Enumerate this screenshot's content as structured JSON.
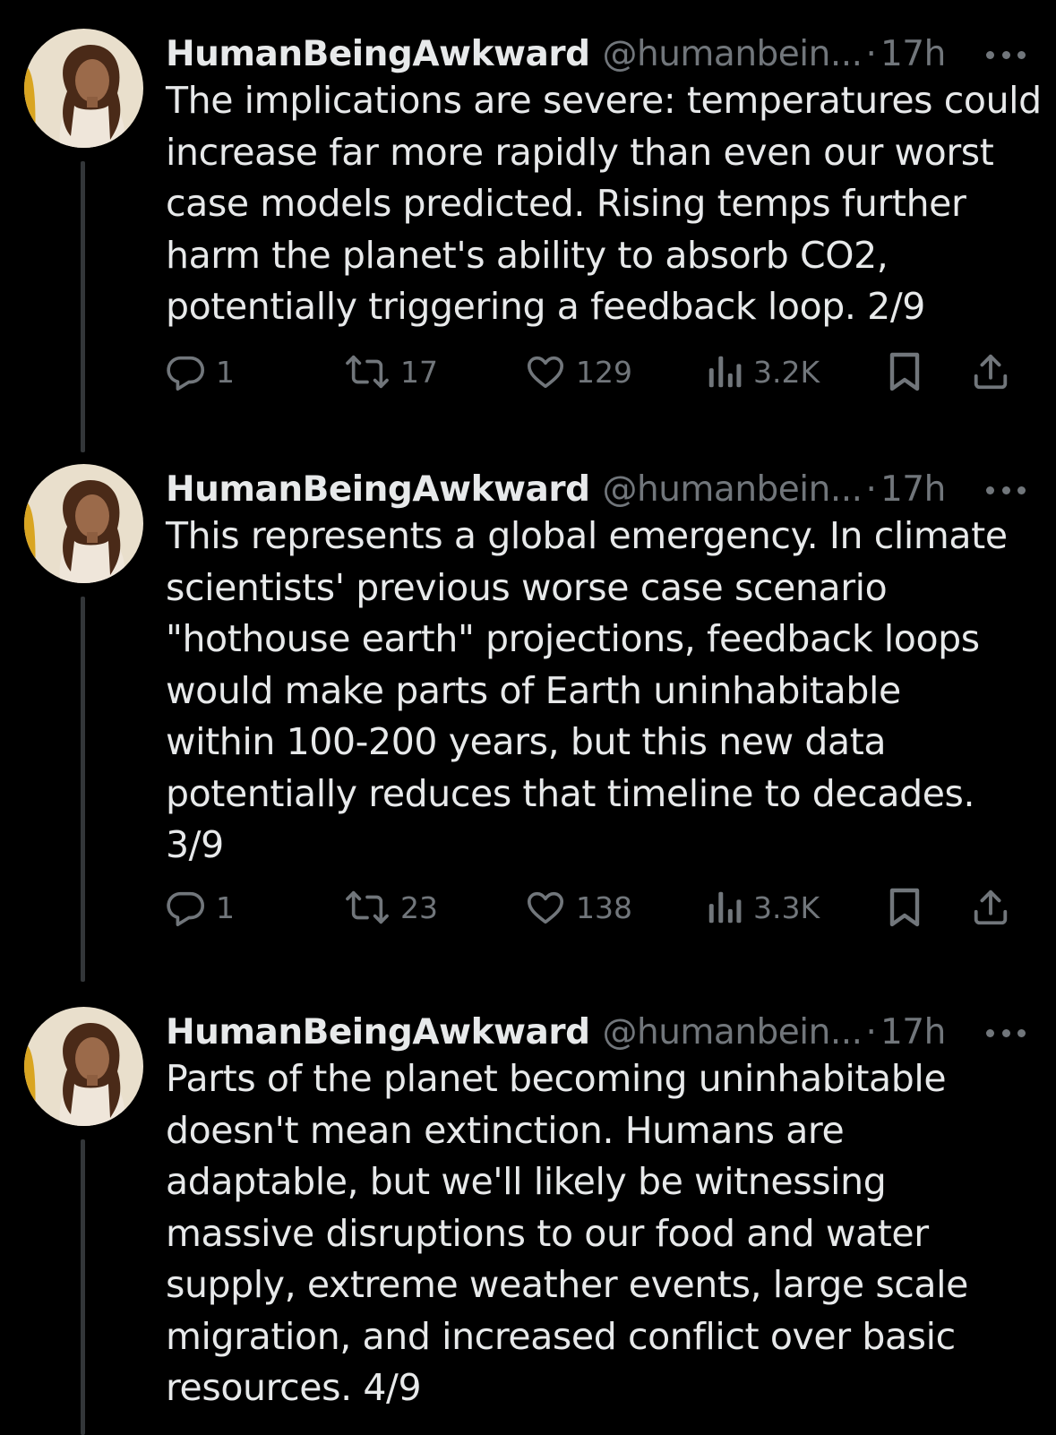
{
  "colors": {
    "background": "#000000",
    "text_primary": "#e7e9ea",
    "text_secondary": "#71767b",
    "thread_line": "#333639"
  },
  "tweets": [
    {
      "display_name": "HumanBeingAwkward",
      "handle": "@humanbein...",
      "separator": "·",
      "time": "17h",
      "lines": [
        "The implications are severe: temperatures could",
        "increase far more rapidly than even our worst",
        "case models predicted. Rising temps further",
        "harm the planet's ability to absorb CO2,",
        "potentially triggering a feedback loop. 2/9"
      ],
      "replies": "1",
      "retweets": "17",
      "likes": "129",
      "views": "3.2K"
    },
    {
      "display_name": "HumanBeingAwkward",
      "handle": "@humanbein...",
      "separator": "·",
      "time": "17h",
      "lines": [
        "This represents a global emergency. In climate",
        "scientists' previous worse case scenario",
        "\"hothouse earth\" projections, feedback loops",
        "would make parts of Earth uninhabitable",
        "within 100-200 years, but this new data",
        "potentially reduces that timeline to decades.",
        "3/9"
      ],
      "replies": "1",
      "retweets": "23",
      "likes": "138",
      "views": "3.3K"
    },
    {
      "display_name": "HumanBeingAwkward",
      "handle": "@humanbein...",
      "separator": "·",
      "time": "17h",
      "lines": [
        "Parts of the planet becoming uninhabitable",
        "doesn't mean extinction. Humans are",
        "adaptable, but we'll likely be witnessing",
        "massive disruptions to our food and water",
        "supply, extreme weather events, large scale",
        "migration, and increased conflict over basic",
        "resources. 4/9"
      ]
    }
  ]
}
